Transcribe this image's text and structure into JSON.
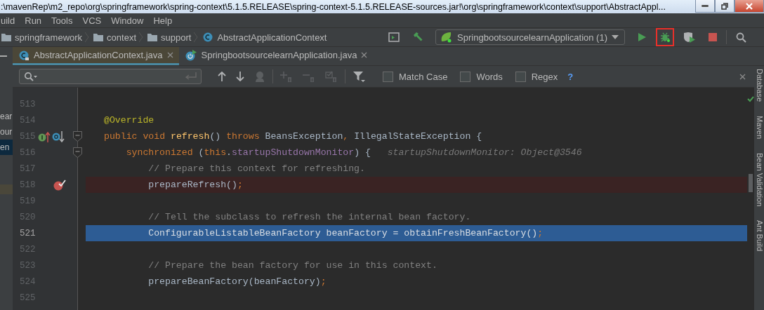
{
  "title_bar": {
    "title": ":\\mavenRep\\m2_repo\\org\\springframework\\spring-context\\5.1.5.RELEASE\\spring-context-5.1.5.RELEASE-sources.jar!\\org\\springframework\\context\\support\\AbstractAppl..."
  },
  "menu": [
    "uild",
    "Run",
    "Tools",
    "VCS",
    "Window",
    "Help"
  ],
  "breadcrumbs": [
    {
      "label": "springframework",
      "kind": "folder"
    },
    {
      "label": "context",
      "kind": "folder"
    },
    {
      "label": "support",
      "kind": "folder"
    },
    {
      "label": "AbstractApplicationContext",
      "kind": "class"
    }
  ],
  "toolbar": {
    "run_config": "SpringbootsourcelearnApplication (1)",
    "buttons": [
      {
        "kind": "terminal",
        "highlighted": false
      },
      {
        "kind": "build",
        "highlighted": false
      },
      {
        "kind": "config"
      },
      {
        "kind": "run",
        "highlighted": false
      },
      {
        "kind": "debug",
        "highlighted": true
      },
      {
        "kind": "coverage",
        "highlighted": false
      },
      {
        "kind": "stop",
        "highlighted": false
      },
      {
        "kind": "divider"
      },
      {
        "kind": "search",
        "highlighted": false
      }
    ]
  },
  "left_panel": [
    {
      "text": "ear",
      "selected": false
    },
    {
      "text": "our",
      "selected": false
    },
    {
      "text": "en",
      "selected": true
    }
  ],
  "tabs": [
    {
      "label": "AbstractApplicationContext.java",
      "kind": "class",
      "selected": true
    },
    {
      "label": "SpringbootsourcelearnApplication.java",
      "kind": "app",
      "selected": false
    }
  ],
  "search_bar": {
    "buttons": [
      {
        "kind": "previous",
        "disabled": false
      },
      {
        "kind": "next",
        "disabled": false
      },
      {
        "kind": "find-all",
        "disabled": true
      },
      {
        "kind": "divider"
      },
      {
        "kind": "add",
        "disabled": true
      },
      {
        "kind": "remove",
        "disabled": true
      },
      {
        "kind": "select-all",
        "disabled": true
      },
      {
        "kind": "divider"
      },
      {
        "kind": "filter",
        "disabled": false
      }
    ],
    "options": [
      {
        "label": "Match Case",
        "checked": false
      },
      {
        "label": "Words",
        "checked": false
      },
      {
        "label": "Regex",
        "checked": false
      }
    ],
    "help": "?"
  },
  "editor": {
    "lines": [
      {
        "number": "513",
        "breakpoint": false,
        "current": false,
        "foldable": false
      },
      {
        "number": "514",
        "tokens": [
          {
            "kind": "annotation",
            "text": "@Override"
          }
        ],
        "breakpoint": false,
        "current": false,
        "foldable": false
      },
      {
        "number": "515",
        "tokens": [
          {
            "kind": "keyword",
            "text": "public void "
          },
          {
            "kind": "declaration",
            "text": "refresh"
          },
          {
            "kind": "plain",
            "text": "() "
          },
          {
            "kind": "keyword",
            "text": "throws "
          },
          {
            "kind": "plain",
            "text": "BeansException"
          },
          {
            "kind": "keyword",
            "text": ", "
          },
          {
            "kind": "plain",
            "text": "IllegalStateException {"
          }
        ],
        "markers": [
          {
            "kind": "implements"
          },
          {
            "kind": "overridden"
          }
        ],
        "breakpoint": false,
        "current": false,
        "foldable": true
      },
      {
        "number": "516",
        "tokens": [
          {
            "kind": "keyword",
            "text": "    synchronized "
          },
          {
            "kind": "plain",
            "text": "("
          },
          {
            "kind": "keyword",
            "text": "this"
          },
          {
            "kind": "plain",
            "text": "."
          },
          {
            "kind": "field",
            "text": "startupShutdownMonitor"
          },
          {
            "kind": "plain",
            "text": ") {"
          }
        ],
        "hint": "startupShutdownMonitor: Object@3546",
        "breakpoint": false,
        "current": false,
        "foldable": true
      },
      {
        "number": "517",
        "tokens": [
          {
            "kind": "comment",
            "text": "        // Prepare this context for refreshing."
          }
        ],
        "breakpoint": false,
        "current": false,
        "foldable": false
      },
      {
        "number": "518",
        "tokens": [
          {
            "kind": "plain",
            "text": "        prepareRefresh()"
          },
          {
            "kind": "keyword",
            "text": ";"
          }
        ],
        "breakpoint": true,
        "current": false,
        "foldable": false
      },
      {
        "number": "519",
        "breakpoint": false,
        "current": false,
        "foldable": false
      },
      {
        "number": "520",
        "tokens": [
          {
            "kind": "comment",
            "text": "        // Tell the subclass to refresh the internal bean factory."
          }
        ],
        "breakpoint": false,
        "current": false,
        "foldable": false
      },
      {
        "number": "521",
        "tokens": [
          {
            "kind": "plain",
            "text": "        ConfigurableListableBeanFactory beanFactory = obtainFreshBeanFactory()"
          },
          {
            "kind": "keyword",
            "text": ";"
          }
        ],
        "breakpoint": false,
        "current": true,
        "foldable": false
      },
      {
        "number": "522",
        "breakpoint": false,
        "current": false,
        "foldable": false
      },
      {
        "number": "523",
        "tokens": [
          {
            "kind": "comment",
            "text": "        // Prepare the bean factory for use in this context."
          }
        ],
        "breakpoint": false,
        "current": false,
        "foldable": false
      },
      {
        "number": "524",
        "tokens": [
          {
            "kind": "plain",
            "text": "        prepareBeanFactory(beanFactory)"
          },
          {
            "kind": "keyword",
            "text": ";"
          }
        ],
        "breakpoint": false,
        "current": false,
        "foldable": false
      },
      {
        "number": "525",
        "breakpoint": false,
        "current": false,
        "foldable": false
      }
    ]
  },
  "tool_windows": [
    "Database",
    "Maven",
    "Bean Validation",
    "Ant Build"
  ]
}
